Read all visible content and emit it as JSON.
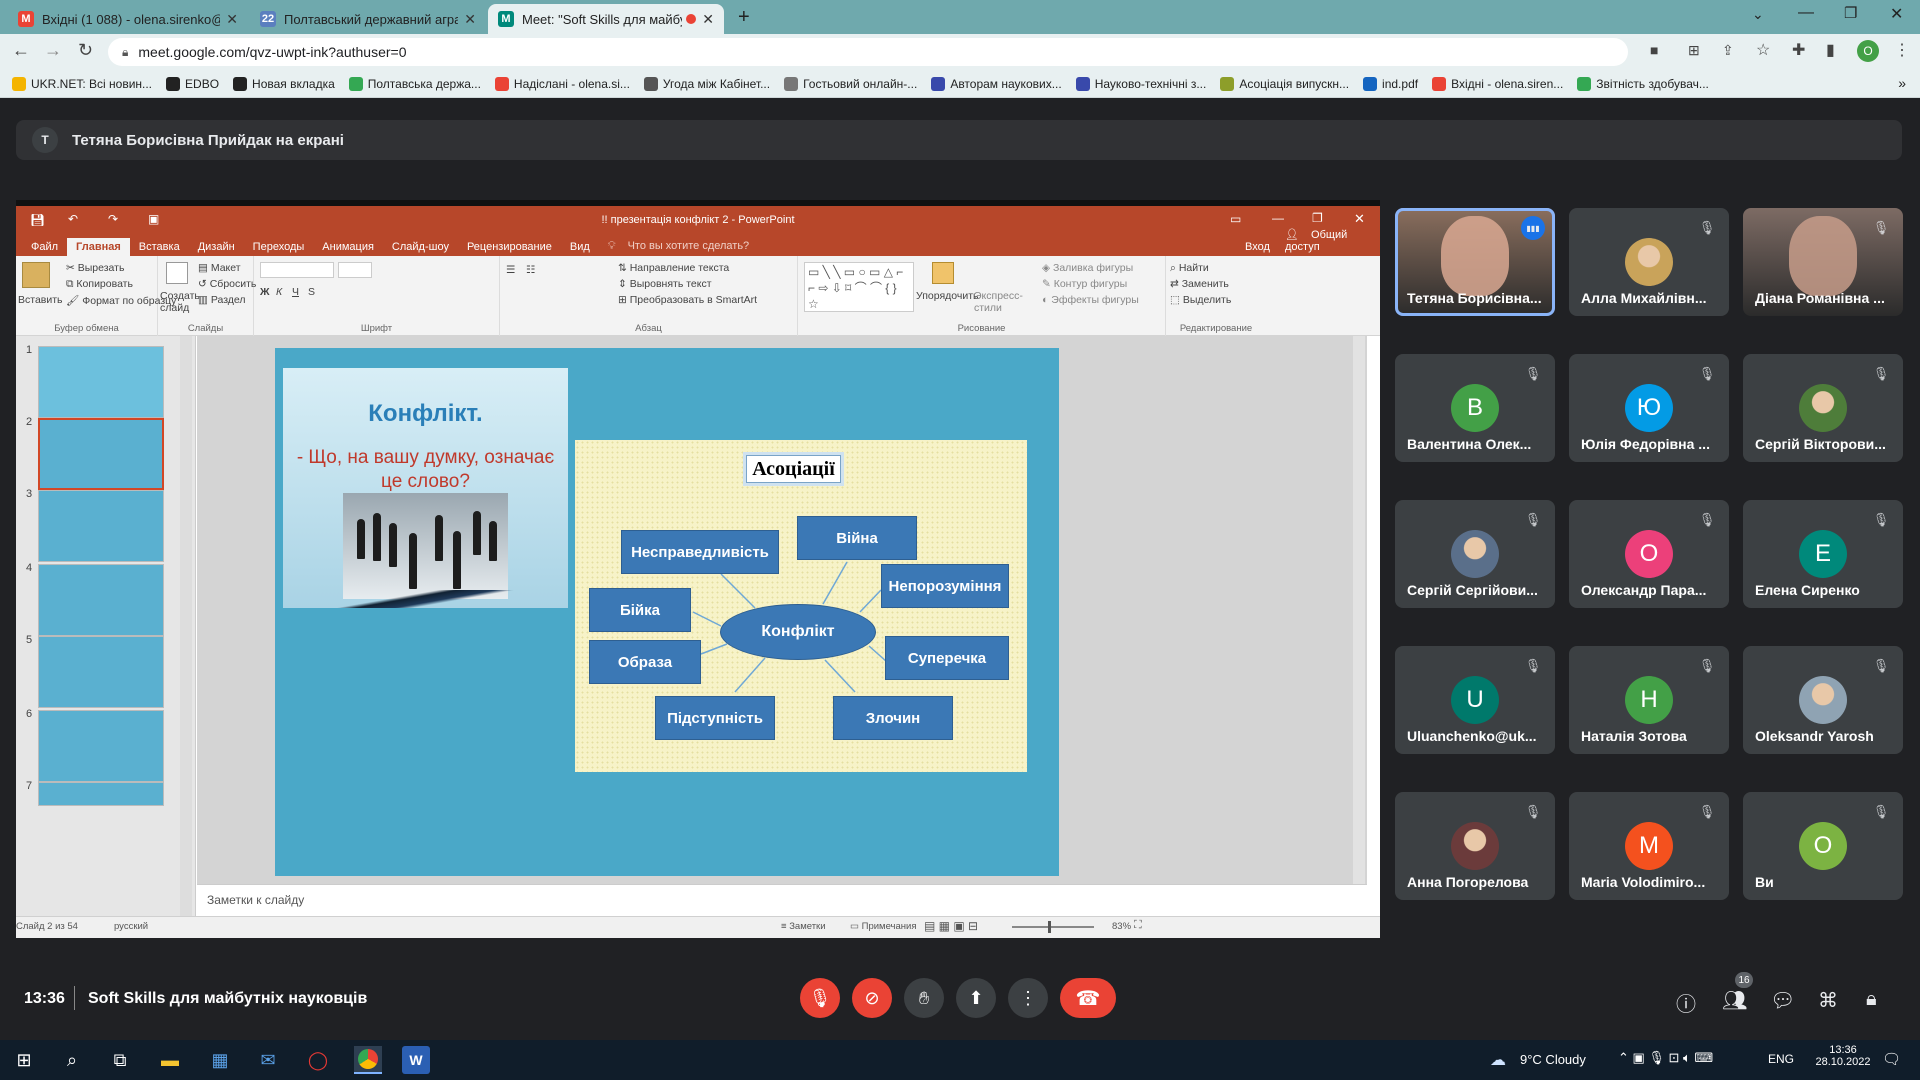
{
  "browser": {
    "tabs": [
      {
        "title": "Вхідні (1 088) - olena.sirenko@p",
        "fav_letter": "M",
        "fav_color": "#ea4335"
      },
      {
        "title": "Полтавський державний аграр",
        "fav_letter": "22",
        "fav_color": "#5b7fbf"
      },
      {
        "title": "Meet: \"Soft Skills для майбут",
        "fav_letter": "M",
        "fav_color": "#00897b"
      }
    ],
    "url": "meet.google.com/qvz-uwpt-ink?authuser=0",
    "profile_letter": "O",
    "bookmarks": [
      {
        "label": "UKR.NET: Всі новин...",
        "color": "#f4b400"
      },
      {
        "label": "EDBO",
        "color": "#222"
      },
      {
        "label": "Новая вкладка",
        "color": "#222"
      },
      {
        "label": "Полтавська держа...",
        "color": "#34a853"
      },
      {
        "label": "Надіслані - olena.si...",
        "color": "#ea4335"
      },
      {
        "label": "Угода між Кабінет...",
        "color": "#555"
      },
      {
        "label": "Гостьовий онлайн-...",
        "color": "#777"
      },
      {
        "label": "Авторам наукових...",
        "color": "#3949ab"
      },
      {
        "label": "Науково-технічні з...",
        "color": "#3949ab"
      },
      {
        "label": "Асоціація випускн...",
        "color": "#8d9e2a"
      },
      {
        "label": "ind.pdf",
        "color": "#1565c0"
      },
      {
        "label": "Вхідні - olena.siren...",
        "color": "#ea4335"
      },
      {
        "label": "Звітність здобувач...",
        "color": "#34a853"
      }
    ]
  },
  "banner": {
    "avatar": "T",
    "text": "Тетяна Борисівна Прийдак на екрані"
  },
  "ppt": {
    "title": "!! презентація конфлікт 2 - PowerPoint",
    "menu": [
      "Файл",
      "Главная",
      "Вставка",
      "Дизайн",
      "Переходы",
      "Анимация",
      "Слайд-шоу",
      "Рецензирование",
      "Вид"
    ],
    "tell_me": "Что вы хотите сделать?",
    "login": "Вход",
    "share": "Общий доступ",
    "ribbon": {
      "paste": "Вставить",
      "cut": "Вырезать",
      "copy": "Копировать",
      "format": "Формат по образцу",
      "g_clipboard": "Буфер обмена",
      "new_slide": "Создать слайд",
      "layout": "Макет",
      "reset": "Сбросить",
      "section": "Раздел",
      "g_slides": "Слайды",
      "g_font": "Шрифт",
      "text_dir": "Направление текста",
      "align_text": "Выровнять текст",
      "smartart": "Преобразовать в SmartArt",
      "g_para": "Абзац",
      "arrange": "Упорядочить",
      "quick_styles": "Экспресс-стили",
      "fill": "Заливка фигуры",
      "outline": "Контур фигуры",
      "effects": "Эффекты фигуры",
      "g_draw": "Рисование",
      "find": "Найти",
      "replace": "Заменить",
      "select": "Выделить",
      "g_edit": "Редактирование"
    },
    "thumb_numbers": [
      "1",
      "2",
      "3",
      "4",
      "5",
      "6",
      "7"
    ],
    "notes_placeholder": "Заметки к слайду",
    "status": {
      "slide": "Слайд 2 из 54",
      "lang": "русский",
      "notes": "Заметки",
      "comments": "Примечания",
      "zoom": "83%"
    },
    "slide": {
      "title": "Конфлікт.",
      "question": "- Що, на вашу думку, означає це слово?",
      "assoc": "Асоціації",
      "center": "Конфлікт",
      "boxes": [
        "Несправедливість",
        "Війна",
        "Непорозуміння",
        "Бійка",
        "Образа",
        "Суперечка",
        "Підступність",
        "Злочин"
      ]
    }
  },
  "participants": [
    {
      "name": "Тетяна Борисівна...",
      "type": "photo",
      "color": "#8b6f5e",
      "speaking": true
    },
    {
      "name": "Алла Михайлівн...",
      "type": "photo",
      "color": "#c9a35a"
    },
    {
      "name": "Діана Романівна ...",
      "type": "photo",
      "color": "#7d6b64"
    },
    {
      "name": "Валентина Олек...",
      "type": "letter",
      "letter": "B",
      "color": "#43a047"
    },
    {
      "name": "Юлія Федорівна ...",
      "type": "letter",
      "letter": "Ю",
      "color": "#039be5"
    },
    {
      "name": "Сергій Вікторови...",
      "type": "photo",
      "color": "#4e7d3a"
    },
    {
      "name": "Сергій Сергійови...",
      "type": "photo",
      "color": "#5a6f8a"
    },
    {
      "name": "Олександр Пара...",
      "type": "letter",
      "letter": "O",
      "color": "#ec407a"
    },
    {
      "name": "Елена Сиренко",
      "type": "letter",
      "letter": "E",
      "color": "#00897b"
    },
    {
      "name": "Uluanchenko@uk...",
      "type": "letter",
      "letter": "U",
      "color": "#00796b"
    },
    {
      "name": "Наталія Зотова",
      "type": "letter",
      "letter": "H",
      "color": "#43a047"
    },
    {
      "name": "Oleksandr Yarosh",
      "type": "photo",
      "color": "#8fa3b3"
    },
    {
      "name": "Анна Погорелова",
      "type": "photo",
      "color": "#6b3b3b"
    },
    {
      "name": "Maria Volodimiro...",
      "type": "letter",
      "letter": "M",
      "color": "#f4511e"
    },
    {
      "name": "Ви",
      "type": "letter",
      "letter": "O",
      "color": "#7cb342"
    }
  ],
  "meeting": {
    "time": "13:36",
    "title": "Soft Skills для майбутніх науковців",
    "people_count": "16"
  },
  "taskbar": {
    "weather": "9°C  Cloudy",
    "lang": "ENG",
    "time": "13:36",
    "date": "28.10.2022"
  }
}
